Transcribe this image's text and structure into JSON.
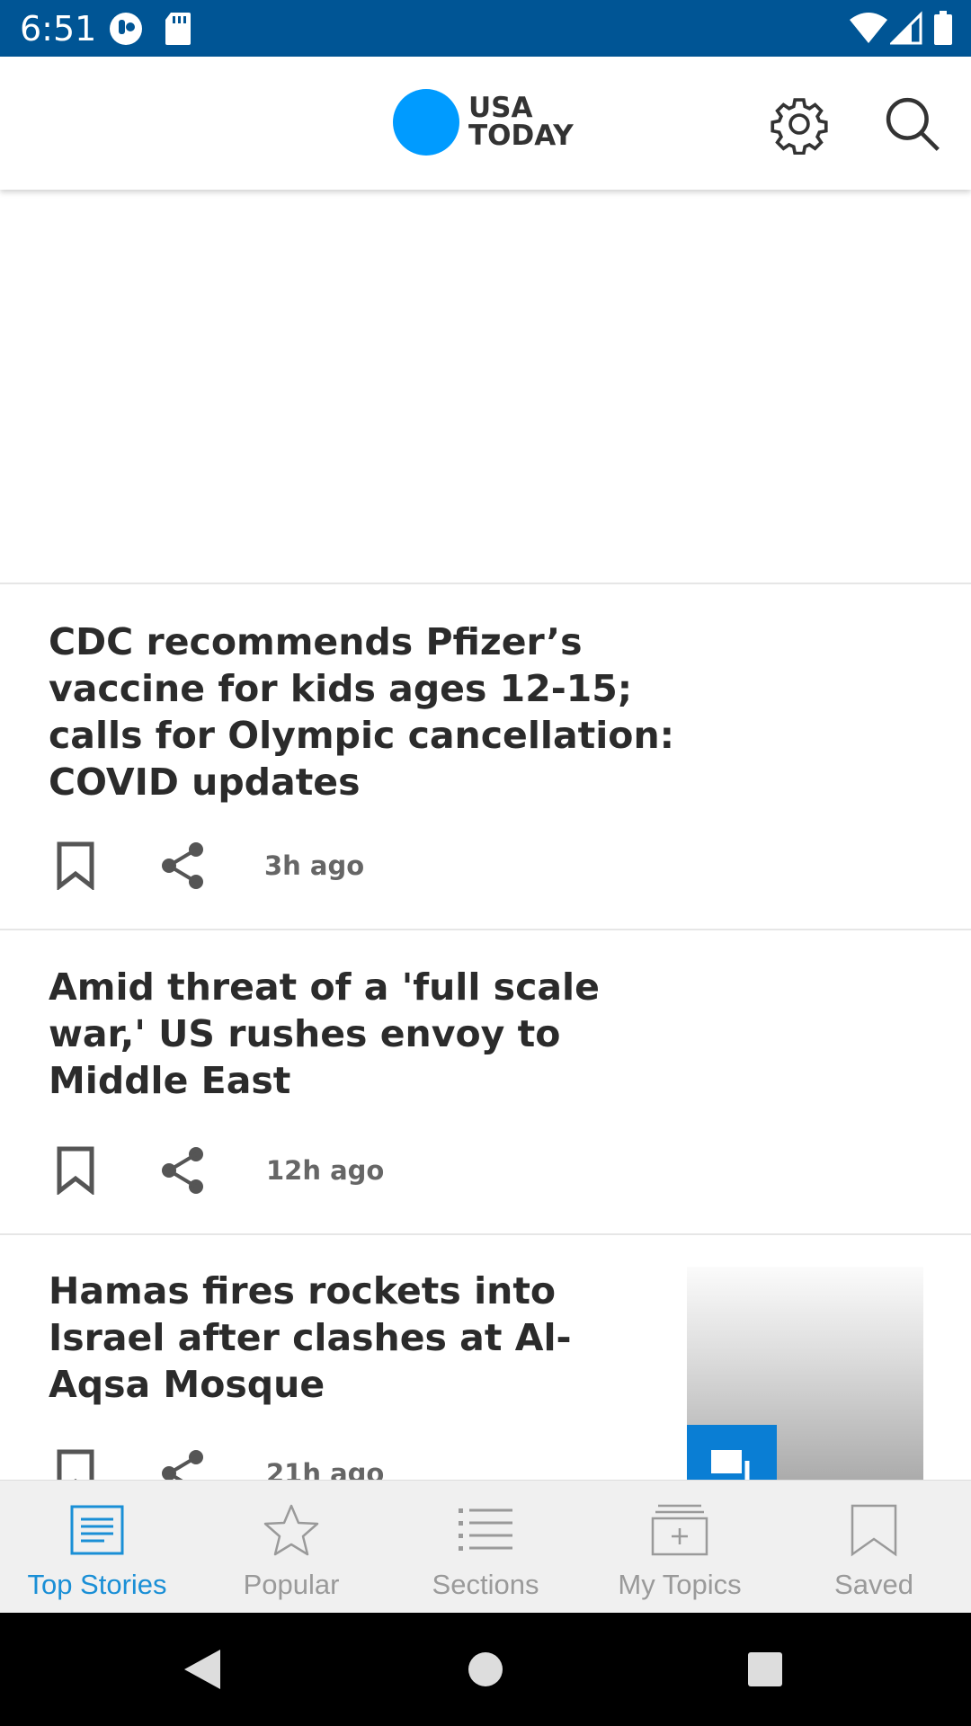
{
  "status_bar": {
    "time": "6:51"
  },
  "app_bar": {
    "logo_line1": "USA",
    "logo_line2": "TODAY",
    "logo_color": "#009bff"
  },
  "stories": [
    {
      "title": "CDC recommends Pfizer’s vaccine for kids ages 12-15; calls for Olympic cancellation: COVID updates",
      "time": "3h ago"
    },
    {
      "title": "Amid threat of a 'full scale war,' US rushes envoy to Middle East",
      "time": "12h ago"
    },
    {
      "title": "Hamas fires rockets into Israel after clashes at Al-Aqsa Mosque",
      "time": "21h ago"
    }
  ],
  "bottom_nav": {
    "items": [
      {
        "label": "Top Stories",
        "icon": "newspaper-icon",
        "active": true
      },
      {
        "label": "Popular",
        "icon": "star-icon",
        "active": false
      },
      {
        "label": "Sections",
        "icon": "list-icon",
        "active": false
      },
      {
        "label": "My Topics",
        "icon": "add-folder-icon",
        "active": false
      },
      {
        "label": "Saved",
        "icon": "bookmark-icon",
        "active": false
      }
    ],
    "active_color": "#1a8fd6",
    "inactive_color": "#9a9a9a"
  }
}
